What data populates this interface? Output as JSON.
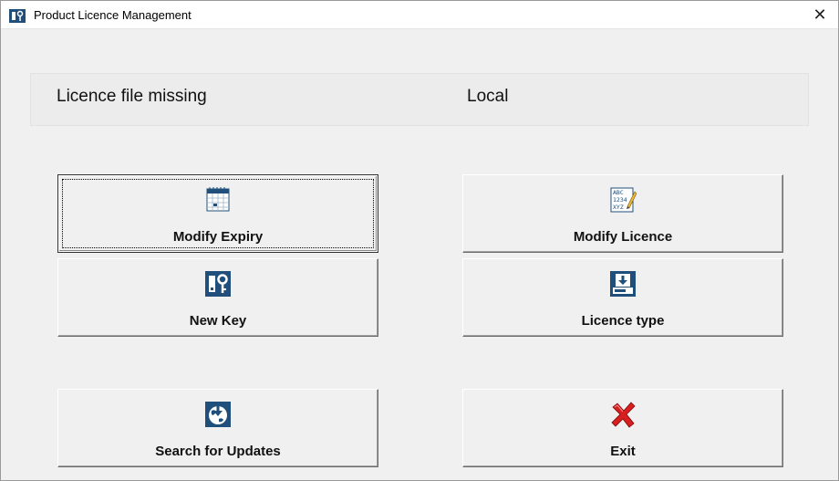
{
  "window": {
    "title": "Product Licence Management",
    "close_glyph": "✕"
  },
  "status": {
    "message": "Licence file missing",
    "mode": "Local"
  },
  "buttons": {
    "modify_expiry": {
      "label": "Modify Expiry",
      "icon": "calendar-icon"
    },
    "modify_licence": {
      "label": "Modify Licence",
      "icon": "edit-document-icon"
    },
    "new_key": {
      "label": "New Key",
      "icon": "key-icon"
    },
    "licence_type": {
      "label": "Licence type",
      "icon": "install-icon"
    },
    "search_updates": {
      "label": "Search for Updates",
      "icon": "globe-download-icon"
    },
    "exit": {
      "label": "Exit",
      "icon": "red-x-icon"
    }
  },
  "colors": {
    "icon_blue": "#1f4f7a",
    "exit_red": "#d81e1e"
  }
}
